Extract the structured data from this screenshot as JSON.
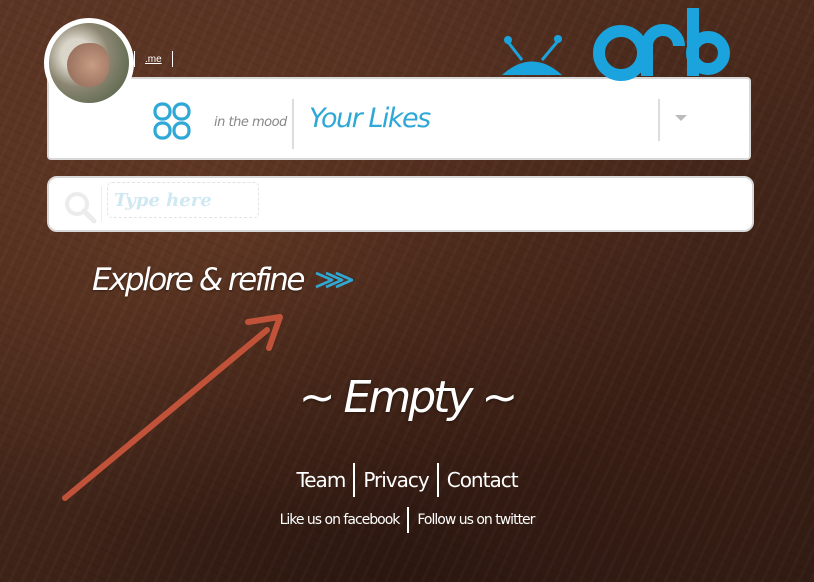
{
  "user": {
    "link_label": ".me"
  },
  "brand": {
    "logo_text": "orb",
    "color": "#1aa3dd"
  },
  "mood": {
    "label": "in the mood",
    "value": "Your Likes"
  },
  "search": {
    "placeholder": "Type here",
    "value": ""
  },
  "explore": {
    "label": "Explore & refine"
  },
  "content": {
    "empty_message": "~ Empty ~"
  },
  "footer": {
    "links": [
      "Team",
      "Privacy",
      "Contact"
    ],
    "social": [
      "Like us on facebook",
      "Follow us on twitter"
    ]
  },
  "colors": {
    "accent": "#2fa8d6",
    "annotation_arrow": "#c0523a"
  }
}
